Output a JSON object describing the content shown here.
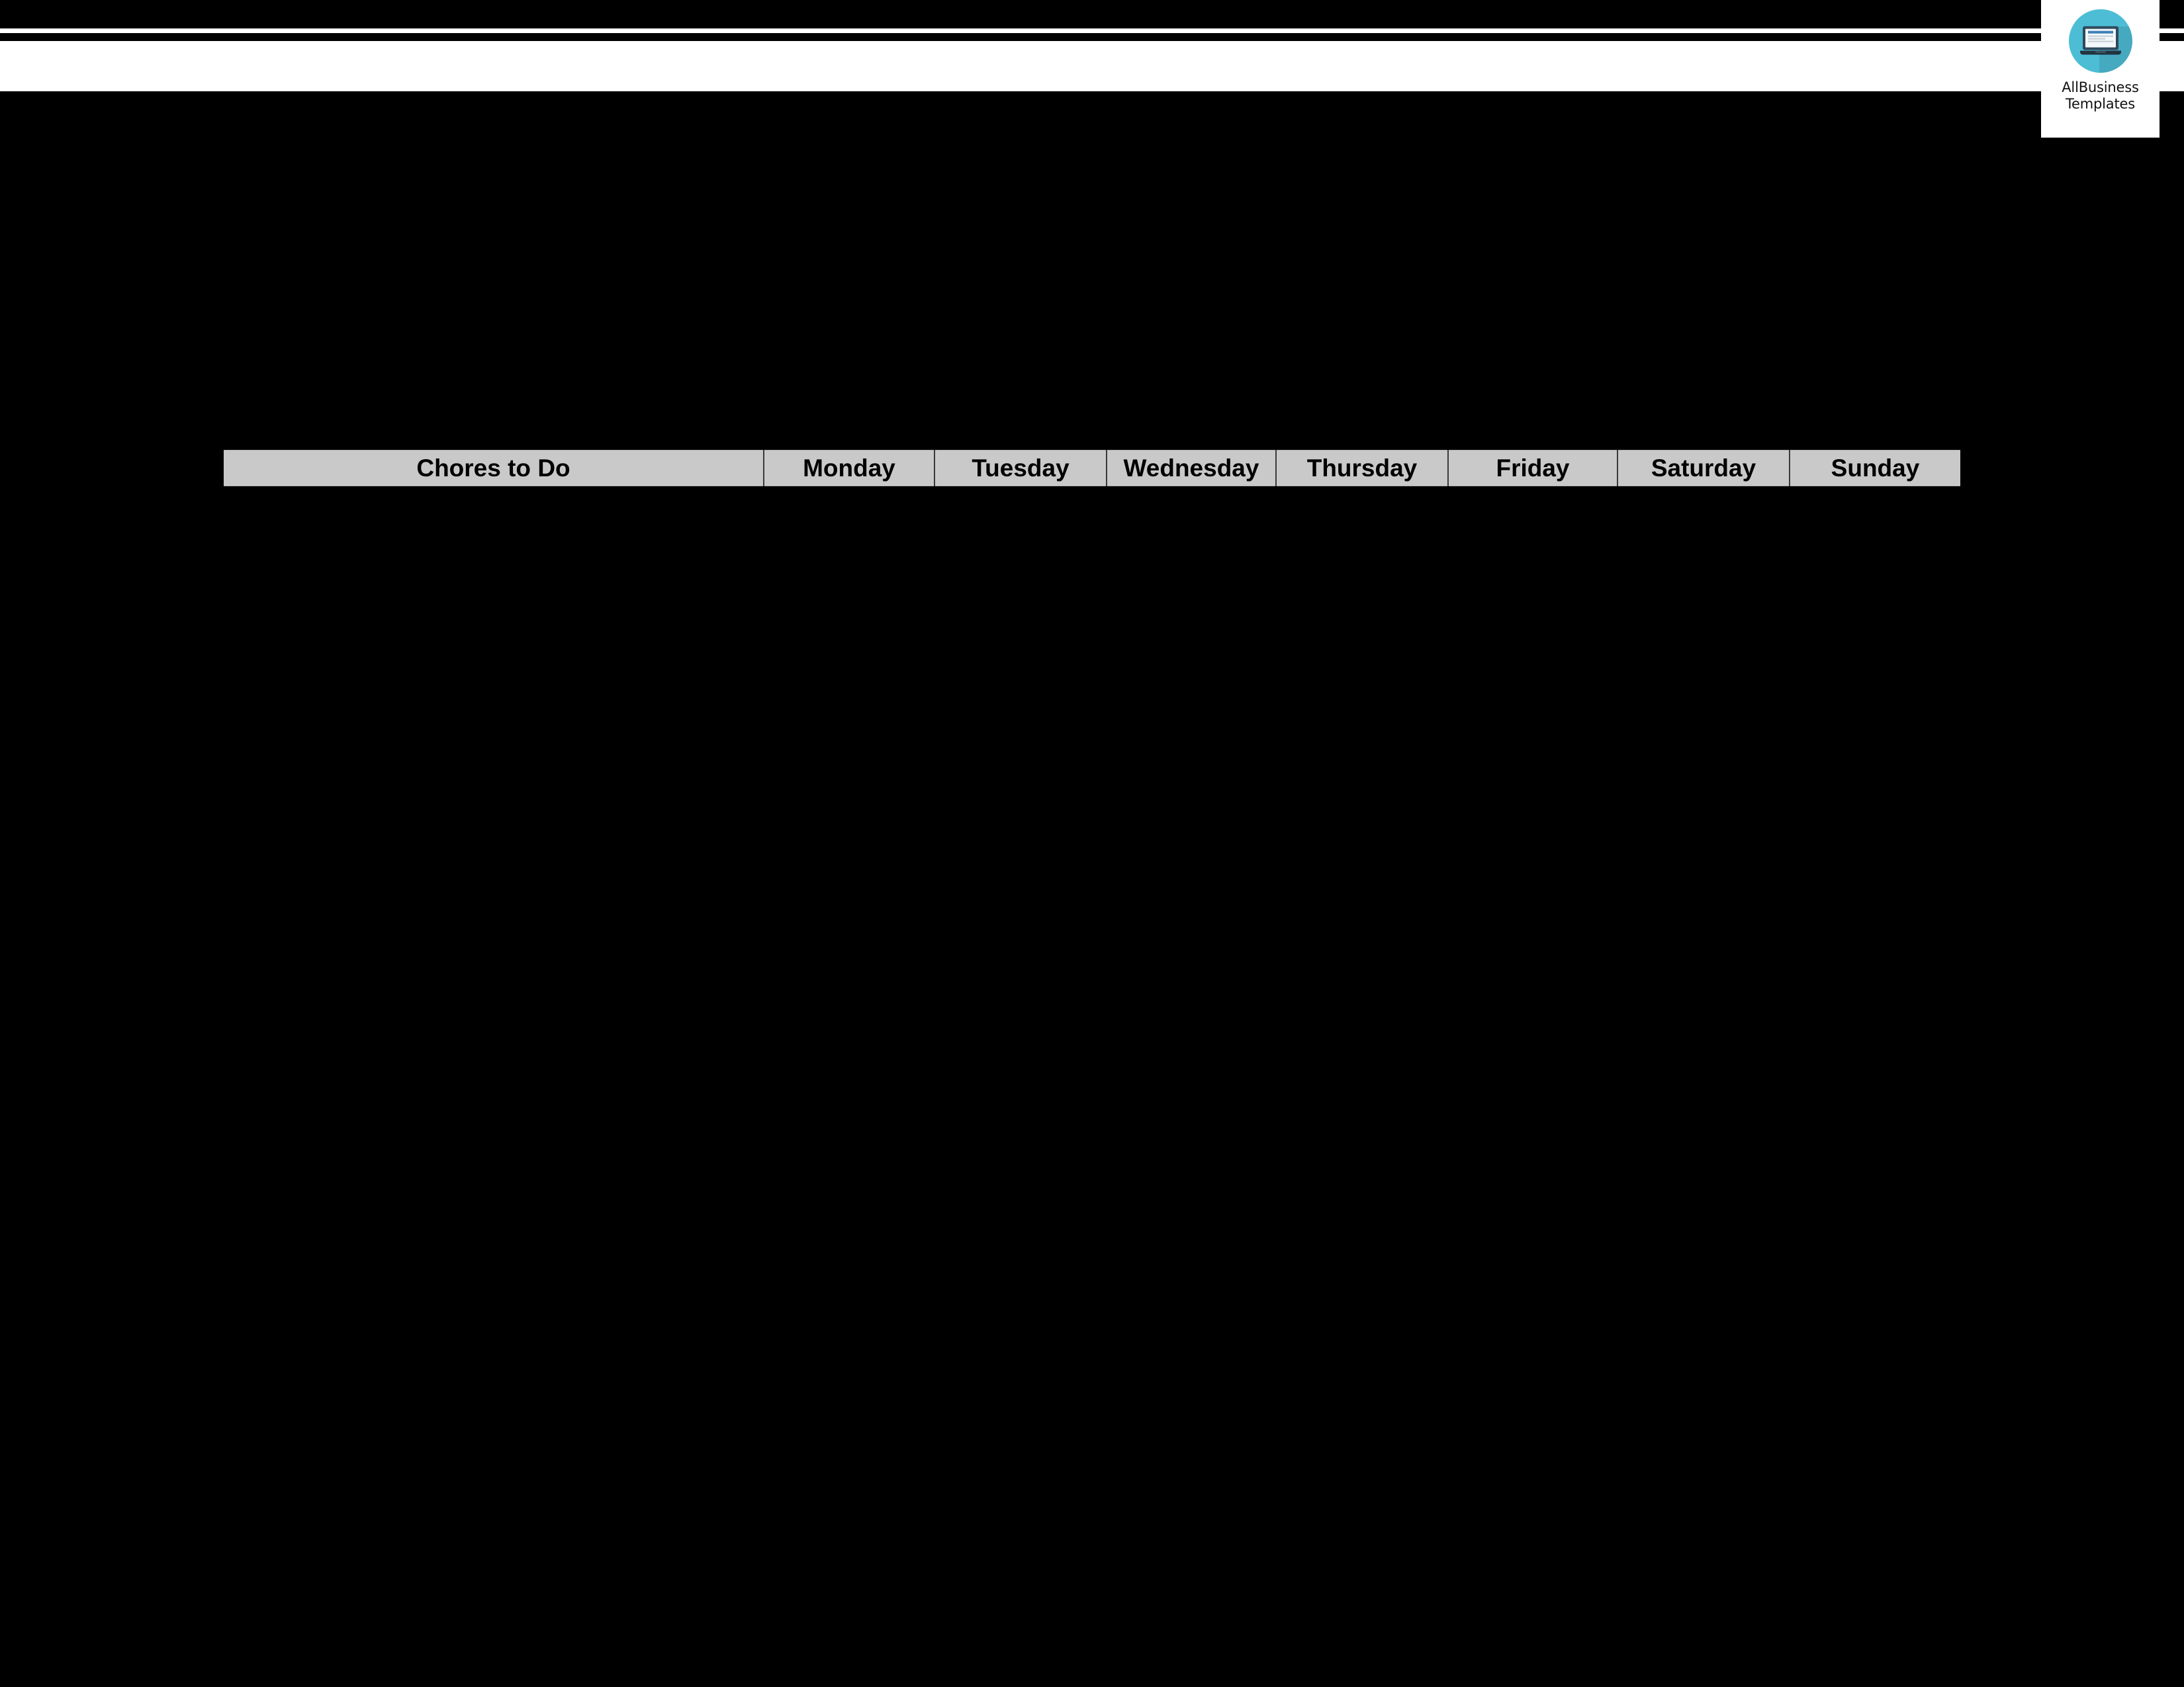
{
  "page": {
    "background_color": "#000000",
    "accent_color": "#4dbdd6",
    "header_fill_color": "#c9c9c9"
  },
  "logo": {
    "icon_name": "laptop-icon",
    "line_one": "AllBusiness",
    "line_two": "Templates"
  },
  "table": {
    "columns": [
      {
        "key": "chores",
        "label": "Chores to Do"
      },
      {
        "key": "monday",
        "label": "Monday"
      },
      {
        "key": "tuesday",
        "label": "Tuesday"
      },
      {
        "key": "wednesday",
        "label": "Wednesday"
      },
      {
        "key": "thursday",
        "label": "Thursday"
      },
      {
        "key": "friday",
        "label": "Friday"
      },
      {
        "key": "saturday",
        "label": "Saturday"
      },
      {
        "key": "sunday",
        "label": "Sunday"
      }
    ],
    "rows": []
  }
}
